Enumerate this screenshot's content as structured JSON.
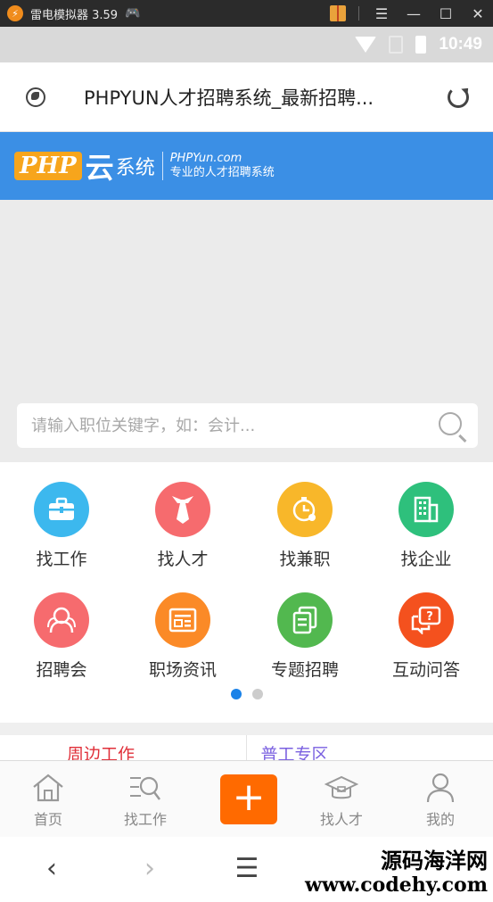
{
  "emulator": {
    "title": "雷电模拟器 3.59"
  },
  "status_bar": {
    "time": "10:49"
  },
  "browser": {
    "page_title": "PHPYUN人才招聘系统_最新招聘..."
  },
  "site_logo": {
    "php": "PHP",
    "yun": "云",
    "system": "系统",
    "domain": "PHPYun.com",
    "slogan": "专业的人才招聘系统"
  },
  "search": {
    "placeholder": "请输入职位关键字，如：会计..."
  },
  "menu": [
    {
      "label": "找工作",
      "icon": "briefcase-icon",
      "color": "#3cb8ee"
    },
    {
      "label": "找人才",
      "icon": "tie-icon",
      "color": "#f66b6e"
    },
    {
      "label": "找兼职",
      "icon": "clock-icon",
      "color": "#f8b72a"
    },
    {
      "label": "找企业",
      "icon": "building-icon",
      "color": "#2ec07c"
    },
    {
      "label": "招聘会",
      "icon": "people-icon",
      "color": "#f66b6e"
    },
    {
      "label": "职场资讯",
      "icon": "news-icon",
      "color": "#fb8a27"
    },
    {
      "label": "专题招聘",
      "icon": "docs-icon",
      "color": "#52b84f"
    },
    {
      "label": "互动问答",
      "icon": "chat-question-icon",
      "color": "#f4511e"
    }
  ],
  "tabs_peek": {
    "left": "周边工作",
    "right": "普工专区"
  },
  "bottom_nav": {
    "home": "首页",
    "jobs": "找工作",
    "talent": "找人才",
    "mine": "我的"
  },
  "watermark": {
    "line1": "源码海洋网",
    "line2": "www.codehy.com"
  }
}
